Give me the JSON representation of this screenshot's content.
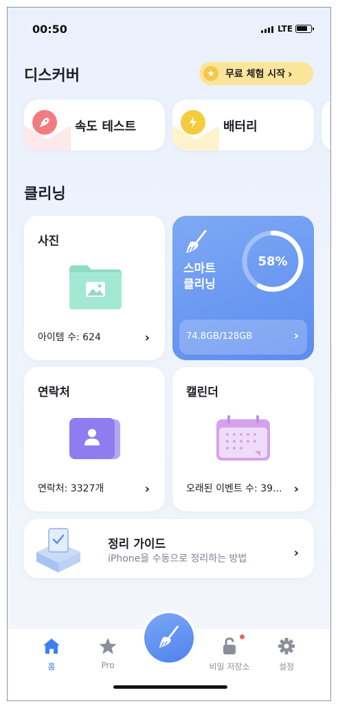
{
  "status": {
    "time": "00:50",
    "network": "LTE"
  },
  "discover": {
    "title": "디스커버",
    "trial_label": "무료 체험 시작",
    "items": [
      {
        "label": "속도 테스트",
        "icon": "rocket-icon",
        "color": "#f16f73"
      },
      {
        "label": "배터리",
        "icon": "lightning-icon",
        "color": "#f5cc3e"
      }
    ]
  },
  "cleaning": {
    "title": "클리닝",
    "photos": {
      "title": "사진",
      "footer": "아이템 수: 624"
    },
    "smart": {
      "label_line1": "스마트",
      "label_line2": "클리닝",
      "percent_text": "58%",
      "progress": 0.58,
      "storage": "74.8GB/128GB"
    },
    "contacts": {
      "title": "연락처",
      "footer": "연락처: 3327개"
    },
    "calendar": {
      "title": "캘린더",
      "footer": "오래된 이벤트 수: 39..."
    }
  },
  "guide": {
    "title": "정리 가이드",
    "subtitle": "iPhone을 수동으로 정리하는 방법"
  },
  "tabbar": {
    "items": [
      {
        "label": "홈",
        "icon": "home-icon",
        "active": true
      },
      {
        "label": "Pro",
        "icon": "star-icon",
        "active": false
      },
      {
        "label": "비밀 저장소",
        "icon": "lock-icon",
        "active": false
      },
      {
        "label": "설정",
        "icon": "gear-icon",
        "active": false
      }
    ]
  },
  "colors": {
    "accent": "#4f82ef",
    "trial_bg": "#fbe59a",
    "badge": "#f0625b"
  }
}
